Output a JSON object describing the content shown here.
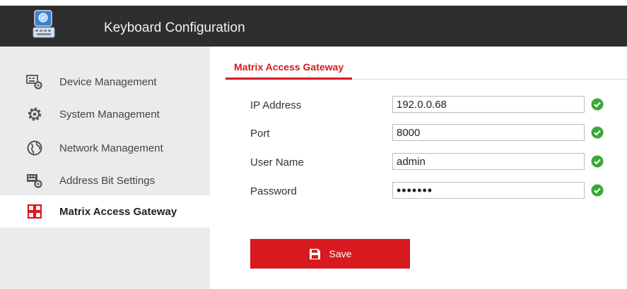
{
  "app": {
    "title": "Keyboard Configuration",
    "icon": "keyboard-app-icon"
  },
  "sidebar": {
    "items": [
      {
        "label": "Device Management",
        "icon": "device-management-icon",
        "active": false
      },
      {
        "label": "System Management",
        "icon": "gear-icon",
        "active": false
      },
      {
        "label": "Network Management",
        "icon": "globe-icon",
        "active": false
      },
      {
        "label": "Address Bit Settings",
        "icon": "address-bit-settings-icon",
        "active": false
      },
      {
        "label": "Matrix Access Gateway",
        "icon": "matrix-grid-icon",
        "active": true
      }
    ]
  },
  "main": {
    "tab": "Matrix Access Gateway",
    "form": {
      "ip_label": "IP Address",
      "ip_value": "192.0.0.68",
      "port_label": "Port",
      "port_value": "8000",
      "user_label": "User Name",
      "user_value": "admin",
      "password_label": "Password",
      "password_value": "•••••••"
    },
    "save_label": "Save"
  },
  "colors": {
    "accent": "#d71920",
    "header_bg": "#2e2e2e",
    "sidebar_bg": "#ebebeb",
    "valid": "#3aa83a"
  }
}
